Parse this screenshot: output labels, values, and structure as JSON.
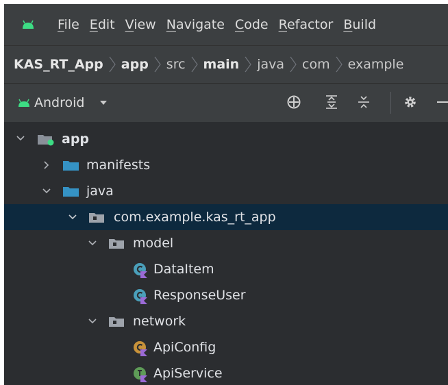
{
  "menu": {
    "items": [
      {
        "mnemonic": "F",
        "rest": "ile"
      },
      {
        "mnemonic": "E",
        "rest": "dit"
      },
      {
        "mnemonic": "V",
        "rest": "iew"
      },
      {
        "mnemonic": "N",
        "rest": "avigate"
      },
      {
        "mnemonic": "C",
        "rest": "ode"
      },
      {
        "mnemonic": "R",
        "rest": "efactor"
      },
      {
        "mnemonic": "B",
        "rest": "uild"
      }
    ]
  },
  "breadcrumb": [
    "KAS_RT_App",
    "app",
    "src",
    "main",
    "java",
    "com",
    "example"
  ],
  "view_selector": {
    "label": "Android"
  },
  "tree": {
    "app": "app",
    "manifests": "manifests",
    "java": "java",
    "package": "com.example.kas_rt_app",
    "model": "model",
    "data_item": "DataItem",
    "response_user": "ResponseUser",
    "network": "network",
    "api_config": "ApiConfig",
    "api_service": "ApiService"
  },
  "colors": {
    "selection": "#0d293e",
    "folder_blue": "#3592c4",
    "android_green": "#3ddc84",
    "class_teal": "#4a9fba",
    "object_orange": "#c8923a",
    "interface_green": "#5e9b57",
    "kotlin_badge": "#9b6ad6"
  }
}
